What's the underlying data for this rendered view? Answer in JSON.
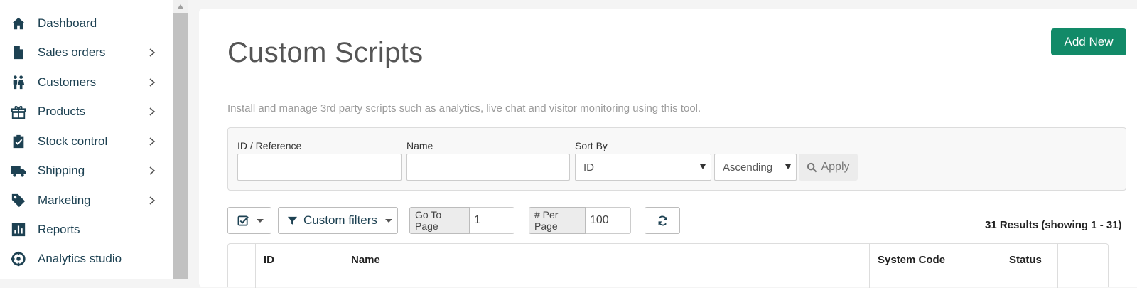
{
  "sidebar": {
    "items": [
      {
        "label": "Dashboard",
        "icon": "home-icon",
        "has_submenu": false
      },
      {
        "label": "Sales orders",
        "icon": "document-icon",
        "has_submenu": true
      },
      {
        "label": "Customers",
        "icon": "people-icon",
        "has_submenu": true
      },
      {
        "label": "Products",
        "icon": "gift-box-icon",
        "has_submenu": true
      },
      {
        "label": "Stock control",
        "icon": "clipboard-check-icon",
        "has_submenu": true
      },
      {
        "label": "Shipping",
        "icon": "truck-icon",
        "has_submenu": true
      },
      {
        "label": "Marketing",
        "icon": "tag-icon",
        "has_submenu": true
      },
      {
        "label": "Reports",
        "icon": "bar-chart-icon",
        "has_submenu": false
      },
      {
        "label": "Analytics studio",
        "icon": "analytics-icon",
        "has_submenu": false
      }
    ]
  },
  "page": {
    "title": "Custom Scripts",
    "add_new_label": "Add New",
    "description": "Install and manage 3rd party scripts such as analytics, live chat and visitor monitoring using this tool."
  },
  "filters": {
    "id_label": "ID / Reference",
    "id_value": "",
    "name_label": "Name",
    "name_value": "",
    "sort_label": "Sort By",
    "sort_value": "ID",
    "order_value": "Ascending",
    "apply_label": "Apply"
  },
  "toolbar": {
    "custom_filters_label": "Custom filters",
    "go_to_page_label": "Go To Page",
    "go_to_page_value": "1",
    "per_page_label": "# Per Page",
    "per_page_value": "100",
    "results_text": "31 Results (showing 1 - 31)"
  },
  "table": {
    "columns": [
      "ID",
      "Name",
      "System Code",
      "Status"
    ]
  },
  "colors": {
    "accent": "#128a68",
    "nav_text": "#1d4152"
  }
}
